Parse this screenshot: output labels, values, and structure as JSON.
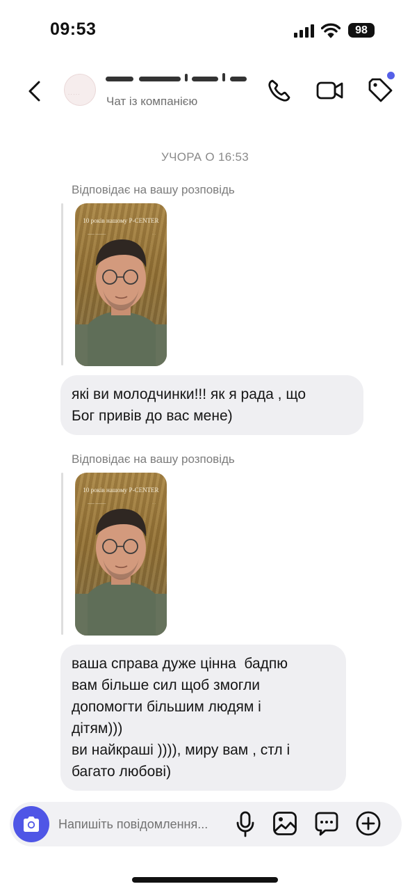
{
  "status": {
    "time": "09:53",
    "battery": "98"
  },
  "header": {
    "subtitle": "Чат із компанією"
  },
  "chat": {
    "day_label": "УЧОРА О 16:53",
    "messages": [
      {
        "reply_label": "Відповідає на вашу розповідь",
        "story_caption": "10 років нашому P-CENTER",
        "text_lines": [
          "які ви молодчинки!!! як я рада , що",
          "Бог привів до вас мене)"
        ]
      },
      {
        "reply_label": "Відповідає на вашу розповідь",
        "story_caption": "10 років нашому P-CENTER",
        "text_lines": [
          "ваша справа дуже цінна  бадпю",
          "вам більше сил щоб змогли",
          "допомогти більшим людям і",
          "дітям)))",
          "ви найкраші )))), миру вам , стл і",
          "багато любові)"
        ]
      }
    ]
  },
  "composer": {
    "placeholder": "Напишіть повідомлення..."
  },
  "colors": {
    "accent": "#4f56e6",
    "bubble": "#efeff2",
    "notification_dot": "#5560e8"
  }
}
